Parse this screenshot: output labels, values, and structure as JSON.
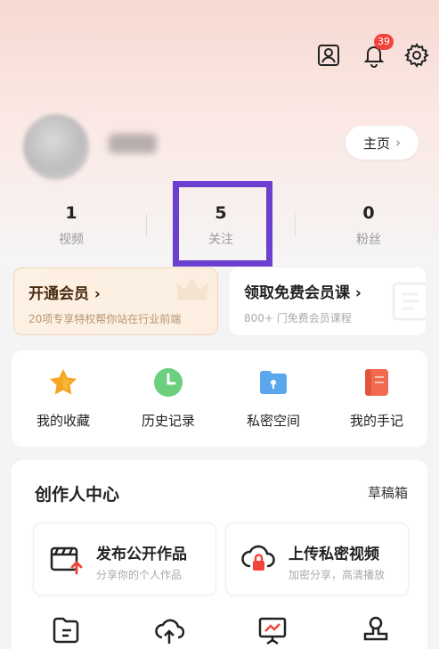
{
  "header": {
    "notification_count": "39",
    "home_button_label": "主页"
  },
  "stats": [
    {
      "value": "1",
      "label": "视频"
    },
    {
      "value": "5",
      "label": "关注"
    },
    {
      "value": "0",
      "label": "粉丝"
    }
  ],
  "promo": {
    "vip_title": "开通会员 ›",
    "vip_subtitle": "20项专享特权帮你站在行业前端",
    "free_title": "领取免费会员课 ›",
    "free_subtitle": "800+ 门免费会员课程"
  },
  "quick_actions": [
    {
      "label": "我的收藏",
      "icon": "star-icon"
    },
    {
      "label": "历史记录",
      "icon": "clock-icon"
    },
    {
      "label": "私密空间",
      "icon": "private-folder-icon"
    },
    {
      "label": "我的手记",
      "icon": "notebook-icon"
    }
  ],
  "creator": {
    "title": "创作人中心",
    "drafts_label": "草稿箱",
    "cards": [
      {
        "title": "发布公开作品",
        "subtitle": "分享你的个人作品",
        "icon": "publish-icon"
      },
      {
        "title": "上传私密视频",
        "subtitle": "加密分享，高清播放",
        "icon": "cloud-lock-icon"
      }
    ]
  },
  "colors": {
    "accent_highlight": "#6b3fd0",
    "badge": "#f2443c",
    "vip_text": "#4a2b10"
  }
}
